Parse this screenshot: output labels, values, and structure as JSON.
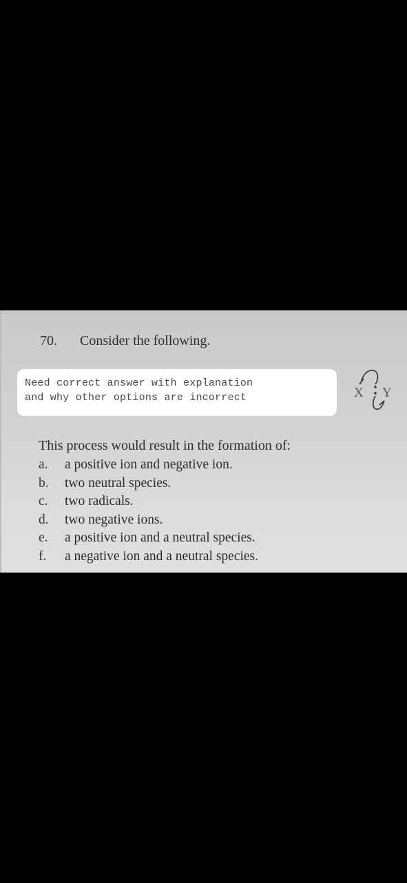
{
  "question": {
    "number": "70.",
    "header": "Consider the following."
  },
  "note": {
    "lines": [
      "Need correct answer with explanation",
      "and why other options are incorrect"
    ]
  },
  "diagram": {
    "left_label": "X",
    "right_label": "Y",
    "description": "curved arrows showing bond electrons splitting between X and Y"
  },
  "prompt": "This process would result in the formation of:",
  "options": [
    {
      "letter": "a.",
      "text": "a positive ion and negative ion."
    },
    {
      "letter": "b.",
      "text": "two neutral species."
    },
    {
      "letter": "c.",
      "text": "two radicals."
    },
    {
      "letter": "d.",
      "text": "two negative ions."
    },
    {
      "letter": "e.",
      "text": "a positive ion and a neutral species."
    },
    {
      "letter": "f.",
      "text": "a negative ion and a neutral species."
    }
  ]
}
